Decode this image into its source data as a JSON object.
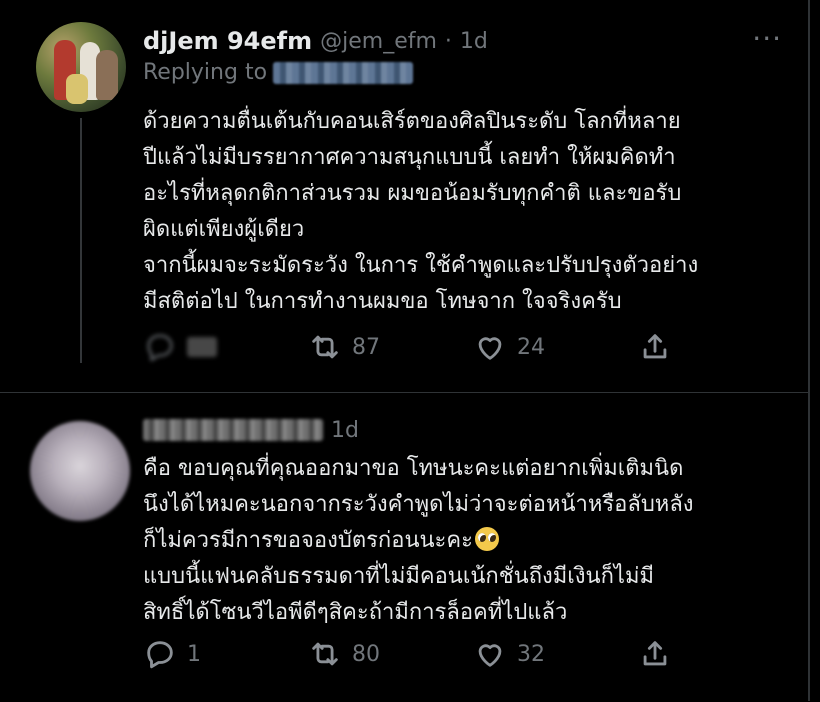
{
  "tweet1": {
    "display_name": "djJem 94efm",
    "handle": "@jem_efm",
    "separator": "·",
    "time": "1d",
    "replying_label": "Replying to",
    "lines": [
      "ด้วยความตื่นเต้นกับคอนเสิร์ตของศิลปินระดับ โลกที่หลาย",
      "ปีแล้วไม่มีบรรยากาศความสนุกแบบนี้ เลยทำ ให้ผมคิดทำ",
      "อะไรที่หลุดกติกาส่วนรวม ผมขอน้อมรับทุกคำติ และขอรับ",
      "ผิดแต่เพียงผู้เดียว",
      "จากนี้ผมจะระมัดระวัง ในการ ใช้คำพูดและปรับปรุงตัวอย่าง",
      "มีสติต่อไป ในการทำงานผมขอ โทษจาก ใจจริงครับ"
    ],
    "actions": {
      "retweets": "87",
      "likes": "24"
    }
  },
  "tweet2": {
    "time": "1d",
    "lines": [
      "คือ ขอบคุณที่คุณออกมาขอ โทษนะคะแต่อยากเพิ่มเติมนิด",
      "นึงได้ไหมคะนอกจากระวังคำพูดไม่ว่าจะต่อหน้าหรือลับหลัง",
      "ก็ไม่ควรมีการขอจองบัตรก่อนนะคะ",
      "แบบนี้แฟนคลับธรรมดาที่ไม่มีคอนเน้กชั่นถึงมีเงินก็ไม่มี",
      "สิทธิ์ได้โซนวีไอพีดีๆสิคะถ้ามีการล็อคที่ไปแล้ว"
    ],
    "actions": {
      "replies": "1",
      "retweets": "80",
      "likes": "32"
    }
  },
  "more_glyph": "···"
}
